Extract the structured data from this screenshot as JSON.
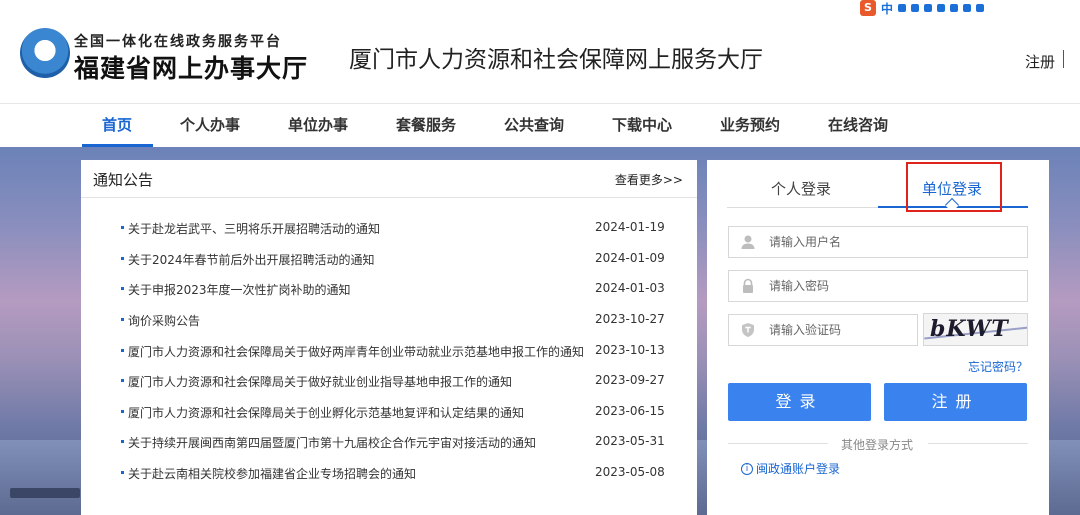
{
  "header": {
    "logo_top": "全国一体化在线政务服务平台",
    "logo_main": "福建省网上办事大厅",
    "site_title": "厦门市人力资源和社会保障网上服务大厅",
    "register_link": "注册"
  },
  "ime": {
    "zh": "中"
  },
  "nav": {
    "items": [
      "首页",
      "个人办事",
      "单位办事",
      "套餐服务",
      "公共查询",
      "下载中心",
      "业务预约",
      "在线咨询"
    ]
  },
  "notice": {
    "title": "通知公告",
    "more": "查看更多>>",
    "items": [
      {
        "text": "关于赴龙岩武平、三明将乐开展招聘活动的通知",
        "date": "2024-01-19"
      },
      {
        "text": "关于2024年春节前后外出开展招聘活动的通知",
        "date": "2024-01-09"
      },
      {
        "text": "关于申报2023年度一次性扩岗补助的通知",
        "date": "2024-01-03"
      },
      {
        "text": "询价采购公告",
        "date": "2023-10-27"
      },
      {
        "text": "厦门市人力资源和社会保障局关于做好两岸青年创业带动就业示范基地申报工作的通知",
        "date": "2023-10-13"
      },
      {
        "text": "厦门市人力资源和社会保障局关于做好就业创业指导基地申报工作的通知",
        "date": "2023-09-27"
      },
      {
        "text": "厦门市人力资源和社会保障局关于创业孵化示范基地复评和认定结果的通知",
        "date": "2023-06-15"
      },
      {
        "text": "关于持续开展闽西南第四届暨厦门市第十九届校企合作元宇宙对接活动的通知",
        "date": "2023-05-31"
      },
      {
        "text": "关于赴云南相关院校参加福建省企业专场招聘会的通知",
        "date": "2023-05-08"
      }
    ]
  },
  "login": {
    "tab_personal": "个人登录",
    "tab_company": "单位登录",
    "username_placeholder": "请输入用户名",
    "password_placeholder": "请输入密码",
    "captcha_placeholder": "请输入验证码",
    "captcha_text": "bKWT",
    "forgot": "忘记密码？",
    "login_button": "登录",
    "register_button": "注册",
    "other_methods": "其他登录方式",
    "mzt_login": "闽政通账户登录"
  },
  "colors": {
    "accent": "#1966d2",
    "button": "#3a82ee",
    "highlight_box": "#e0221c"
  }
}
